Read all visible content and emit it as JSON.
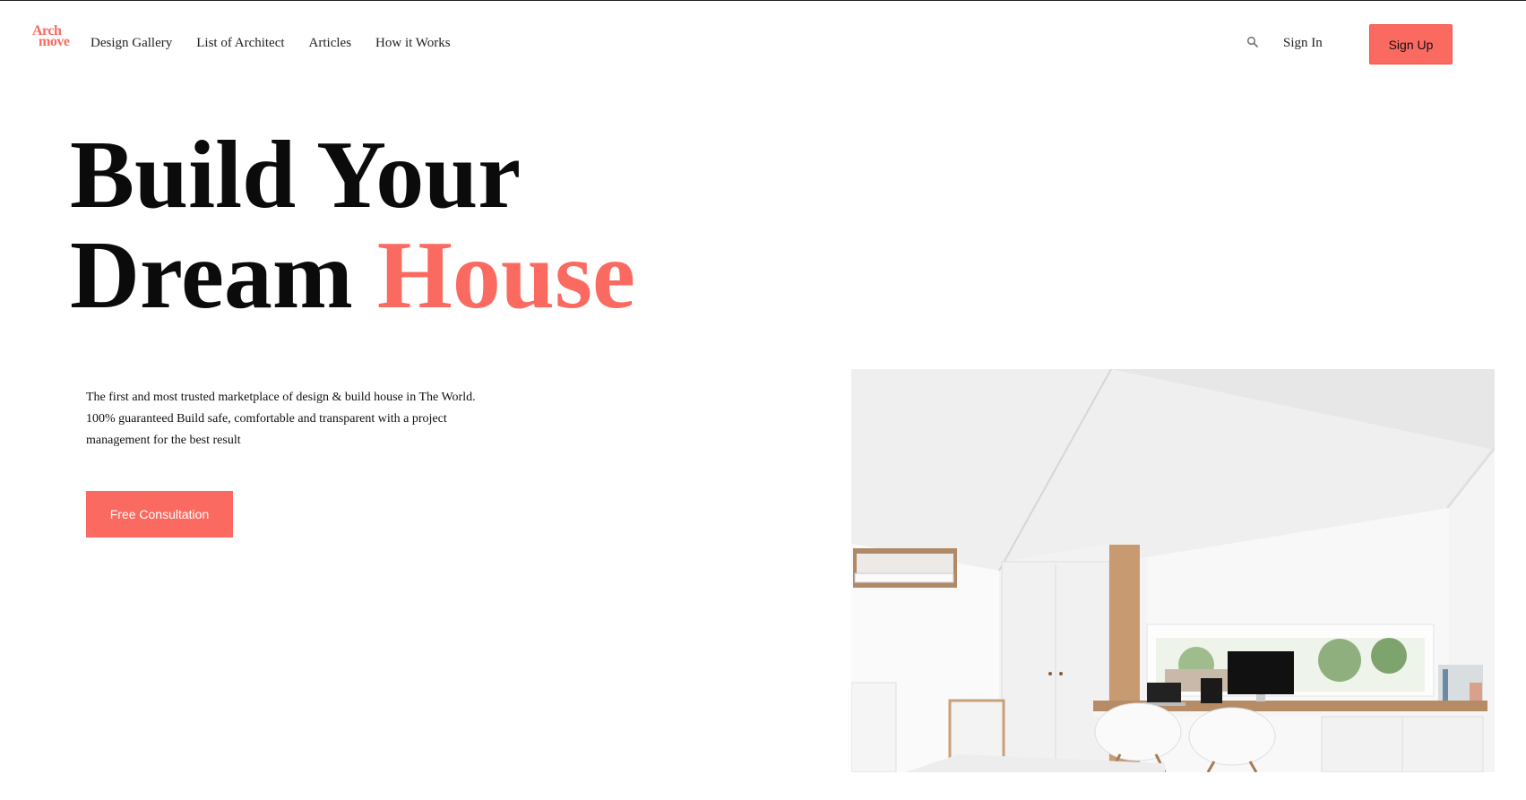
{
  "brand": {
    "logo_line1": "Arch",
    "logo_line2": "move"
  },
  "nav": {
    "items": [
      "Design Gallery",
      "List of Architect",
      "Articles",
      "How it Works"
    ],
    "search_icon": "search-icon",
    "sign_in": "Sign In",
    "sign_up": "Sign Up"
  },
  "hero": {
    "headline_line1": "Build Your",
    "headline_line2_part1": "Dream ",
    "headline_line2_accent": "House",
    "description": "The first and most trusted marketplace of design & build house in The World. 100% guaranteed Build safe, comfortable and transparent with a project management for the best result",
    "cta_label": "Free Consultation"
  },
  "colors": {
    "accent": "#fb6a60",
    "text": "#0b0b0b",
    "background": "#ffffff"
  }
}
